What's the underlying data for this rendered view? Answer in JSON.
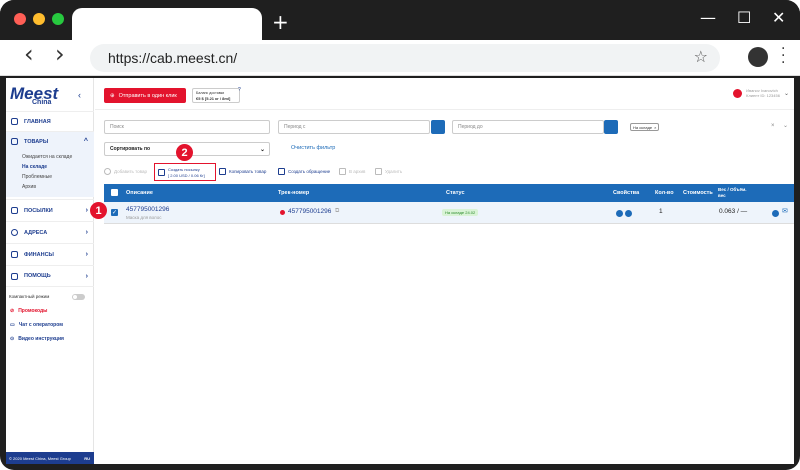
{
  "browser": {
    "url": "https://cab.meest.cn/",
    "new_tab": "+",
    "minimize": "—",
    "maximize": "☐",
    "close": "✕",
    "back": "‹",
    "forward": "›"
  },
  "sidebar": {
    "logo": "Meest",
    "logo_sub": "China",
    "items": [
      {
        "label": "ГЛАВНАЯ"
      },
      {
        "label": "ТОВАРЫ"
      },
      {
        "label": "ПОСЫЛКИ"
      },
      {
        "label": "АДРЕСА"
      },
      {
        "label": "ФИНАНСЫ"
      },
      {
        "label": "ПОМОЩЬ"
      }
    ],
    "sub_items": [
      "Ожидается на складе",
      "На складе",
      "Проблемные",
      "Архив"
    ],
    "compact_mode": "Компактный режим",
    "links": [
      {
        "label": "Промокоды",
        "color": "#e3132d"
      },
      {
        "label": "Чат с оператором",
        "color": "#1d3d8f"
      },
      {
        "label": "Видео инструкция",
        "color": "#1d3d8f"
      }
    ],
    "footer": "© 2020 Meest China, Meest Group",
    "lang": "RU"
  },
  "topbar": {
    "send_button": "Отправить в один клик",
    "balance_label": "Баланс доставки",
    "balance_value": "€5 $ [5.21 кг / 8ml]",
    "user_name": "Ивanov Ivanovich",
    "user_id": "Клиент ID: 123456"
  },
  "filters": {
    "search_placeholder": "Поиск",
    "period_from": "Период с",
    "period_to": "Период до",
    "status_chip": "На складе",
    "sort_label": "Сортировать по",
    "clear": "Очистить фильтр"
  },
  "actions": {
    "add": "Добавить товар",
    "create_line1": "Создать посылку",
    "create_line2": "[ 2.00 USD / 0.06 Кг]",
    "copy": "Копировать товар",
    "appeal": "Создать обращение",
    "archive": "В архив",
    "delete": "Удалить"
  },
  "badges": {
    "one": "1",
    "two": "2"
  },
  "table": {
    "headers": {
      "description": "Описание",
      "track": "Трек-номер",
      "status": "Статус",
      "props": "Свойства",
      "qty": "Кол-во",
      "cost": "Стоимость",
      "weight_l1": "Вес / Объём.",
      "weight_l2": "вес"
    },
    "row": {
      "description": "457795001296",
      "description_sub": "Маска для волос",
      "track": "457795001296",
      "status": "На складе 24.02",
      "qty": "1",
      "weight": "0.063 / —"
    }
  },
  "colors": {
    "accent": "#1d6bb8",
    "brand": "#1d3d8f",
    "red": "#e3132d"
  }
}
